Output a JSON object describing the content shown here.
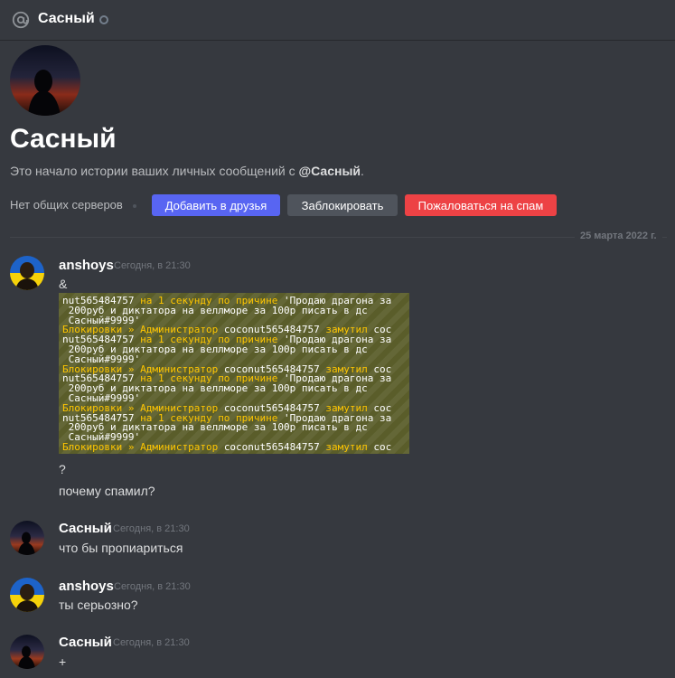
{
  "header": {
    "title": "Сасный",
    "icon": "at-icon",
    "status": "offline"
  },
  "profile": {
    "name": "Сасный",
    "intro_prefix": "Это начало истории ваших личных сообщений с ",
    "intro_user": "@Сасный",
    "intro_suffix": ".",
    "no_servers": "Нет общих серверов"
  },
  "actions": {
    "add_friend": "Добавить в друзья",
    "block": "Заблокировать",
    "report_spam": "Пожаловаться на спам"
  },
  "date_divider": "25 марта 2022 г.",
  "colors": {
    "blurple": "#5865f2",
    "grey_button": "#4f545c",
    "red_button": "#ed4245",
    "background": "#36393f"
  },
  "messages": [
    {
      "author": "anshoys",
      "time": "Сегодня, в 21:30",
      "lines": [
        "&"
      ],
      "after_lines": [
        "?",
        "почему спамил?"
      ]
    },
    {
      "author": "Сасный",
      "time": "Сегодня, в 21:30",
      "lines": [
        "что бы пропиариться"
      ]
    },
    {
      "author": "anshoys",
      "time": "Сегодня, в 21:30",
      "lines": [
        "ты серьозно?"
      ]
    },
    {
      "author": "Сасный",
      "time": "Сегодня, в 21:30",
      "lines": [
        "+"
      ]
    }
  ],
  "attachment": {
    "lines": [
      [
        {
          "t": "nut565484757 ",
          "c": "w"
        },
        {
          "t": "на 1 секунду ",
          "c": "y"
        },
        {
          "t": "по причине ",
          "c": "y"
        },
        {
          "t": "'Продаю драгона за",
          "c": "w"
        }
      ],
      [
        {
          "t": " 200руб и диктатора на веллморе за 100р писать в дс",
          "c": "w"
        }
      ],
      [
        {
          "t": " Сасный#9999'",
          "c": "w"
        }
      ],
      [
        {
          "t": "Блокировки » Администратор ",
          "c": "y"
        },
        {
          "t": "coconut565484757 ",
          "c": "w"
        },
        {
          "t": "замутил ",
          "c": "y"
        },
        {
          "t": "coc",
          "c": "w"
        }
      ],
      [
        {
          "t": "nut565484757 ",
          "c": "w"
        },
        {
          "t": "на 1 секунду ",
          "c": "y"
        },
        {
          "t": "по причине ",
          "c": "y"
        },
        {
          "t": "'Продаю драгона за",
          "c": "w"
        }
      ],
      [
        {
          "t": " 200руб и диктатора на веллморе за 100р писать в дс",
          "c": "w"
        }
      ],
      [
        {
          "t": " Сасный#9999'",
          "c": "w"
        }
      ],
      [
        {
          "t": "Блокировки » Администратор ",
          "c": "y"
        },
        {
          "t": "coconut565484757 ",
          "c": "w"
        },
        {
          "t": "замутил ",
          "c": "y"
        },
        {
          "t": "coc",
          "c": "w"
        }
      ],
      [
        {
          "t": "nut565484757 ",
          "c": "w"
        },
        {
          "t": "на 1 секунду ",
          "c": "y"
        },
        {
          "t": "по причине ",
          "c": "y"
        },
        {
          "t": "'Продаю драгона за",
          "c": "w"
        }
      ],
      [
        {
          "t": " 200руб и диктатора на веллморе за 100р писать в дс",
          "c": "w"
        }
      ],
      [
        {
          "t": " Сасный#9999'",
          "c": "w"
        }
      ],
      [
        {
          "t": "Блокировки » Администратор ",
          "c": "y"
        },
        {
          "t": "coconut565484757 ",
          "c": "w"
        },
        {
          "t": "замутил ",
          "c": "y"
        },
        {
          "t": "coc",
          "c": "w"
        }
      ],
      [
        {
          "t": "nut565484757 ",
          "c": "w"
        },
        {
          "t": "на 1 секунду ",
          "c": "y"
        },
        {
          "t": "по причине ",
          "c": "y"
        },
        {
          "t": "'Продаю драгона за",
          "c": "w"
        }
      ],
      [
        {
          "t": " 200руб и диктатора на веллморе за 100р писать в дс",
          "c": "w"
        }
      ],
      [
        {
          "t": " Сасный#9999'",
          "c": "w"
        }
      ],
      [
        {
          "t": "Блокировки » Администратор ",
          "c": "y"
        },
        {
          "t": "coconut565484757 ",
          "c": "w"
        },
        {
          "t": "замутил ",
          "c": "y"
        },
        {
          "t": "coc",
          "c": "w"
        }
      ]
    ]
  }
}
